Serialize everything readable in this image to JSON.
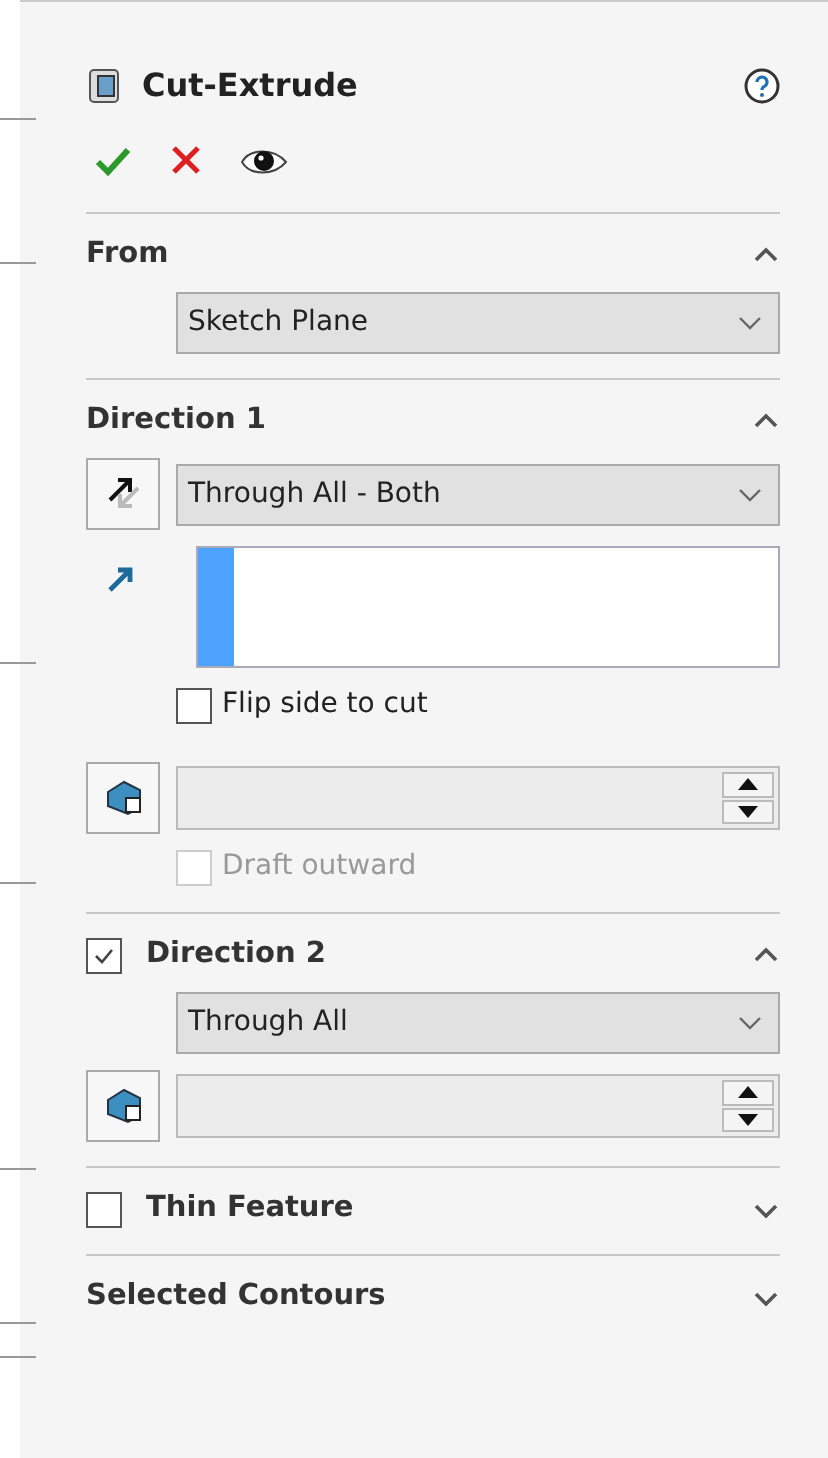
{
  "title": "Cut-Extrude",
  "sections": [
    {
      "title": "From",
      "expanded": true,
      "items": [
        {
          "kind": "select",
          "value": "Sketch Plane"
        }
      ]
    },
    {
      "title": "Direction 1",
      "expanded": true,
      "items": [
        {
          "kind": "select-with-button",
          "value": "Through All - Both"
        },
        {
          "kind": "selection-list"
        },
        {
          "kind": "checkbox",
          "label": "Flip side to cut",
          "checked": false,
          "disabled": false
        },
        {
          "kind": "spinner"
        },
        {
          "kind": "checkbox",
          "label": "Draft outward",
          "checked": false,
          "disabled": true
        }
      ]
    },
    {
      "title": "Direction 2",
      "checked": true,
      "expanded": true,
      "items": [
        {
          "kind": "select",
          "value": "Through All"
        },
        {
          "kind": "spinner"
        }
      ]
    },
    {
      "title": "Thin Feature",
      "checked": false,
      "expanded": false
    },
    {
      "title": "Selected Contours",
      "expanded": false
    }
  ]
}
